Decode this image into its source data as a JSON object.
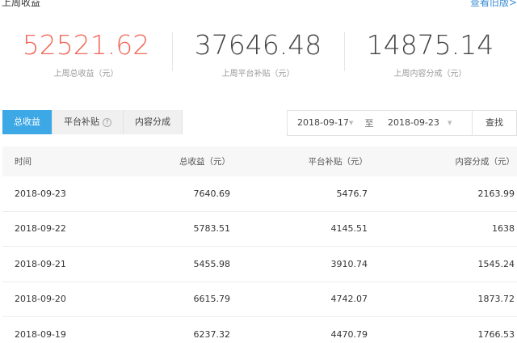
{
  "header": {
    "title": "上周收益",
    "link": "查看旧版>"
  },
  "stats": [
    {
      "value": "52521.62",
      "label": "上周总收益（元）",
      "color": "#f06a5c"
    },
    {
      "value": "37646.48",
      "label": "上周平台补贴（元）"
    },
    {
      "value": "14875.14",
      "label": "上周内容分成（元）"
    }
  ],
  "tabs": [
    {
      "label": "总收益",
      "active": true
    },
    {
      "label": "平台补贴",
      "icon": "help-icon",
      "help_glyph": "?"
    },
    {
      "label": "内容分成"
    }
  ],
  "date_range": {
    "start": "2018-09-17",
    "separator": "至",
    "end": "2018-09-23",
    "search_label": "查找"
  },
  "table": {
    "columns": [
      "时间",
      "总收益（元）",
      "平台补贴（元）",
      "内容分成（元）"
    ],
    "rows": [
      [
        "2018-09-23",
        "7640.69",
        "5476.7",
        "2163.99"
      ],
      [
        "2018-09-22",
        "5783.51",
        "4145.51",
        "1638"
      ],
      [
        "2018-09-21",
        "5455.98",
        "3910.74",
        "1545.24"
      ],
      [
        "2018-09-20",
        "6615.79",
        "4742.07",
        "1873.72"
      ],
      [
        "2018-09-19",
        "6237.32",
        "4470.79",
        "1766.53"
      ]
    ]
  },
  "colors": {
    "accent": "#3da8e6",
    "highlight": "#f06a5c"
  }
}
